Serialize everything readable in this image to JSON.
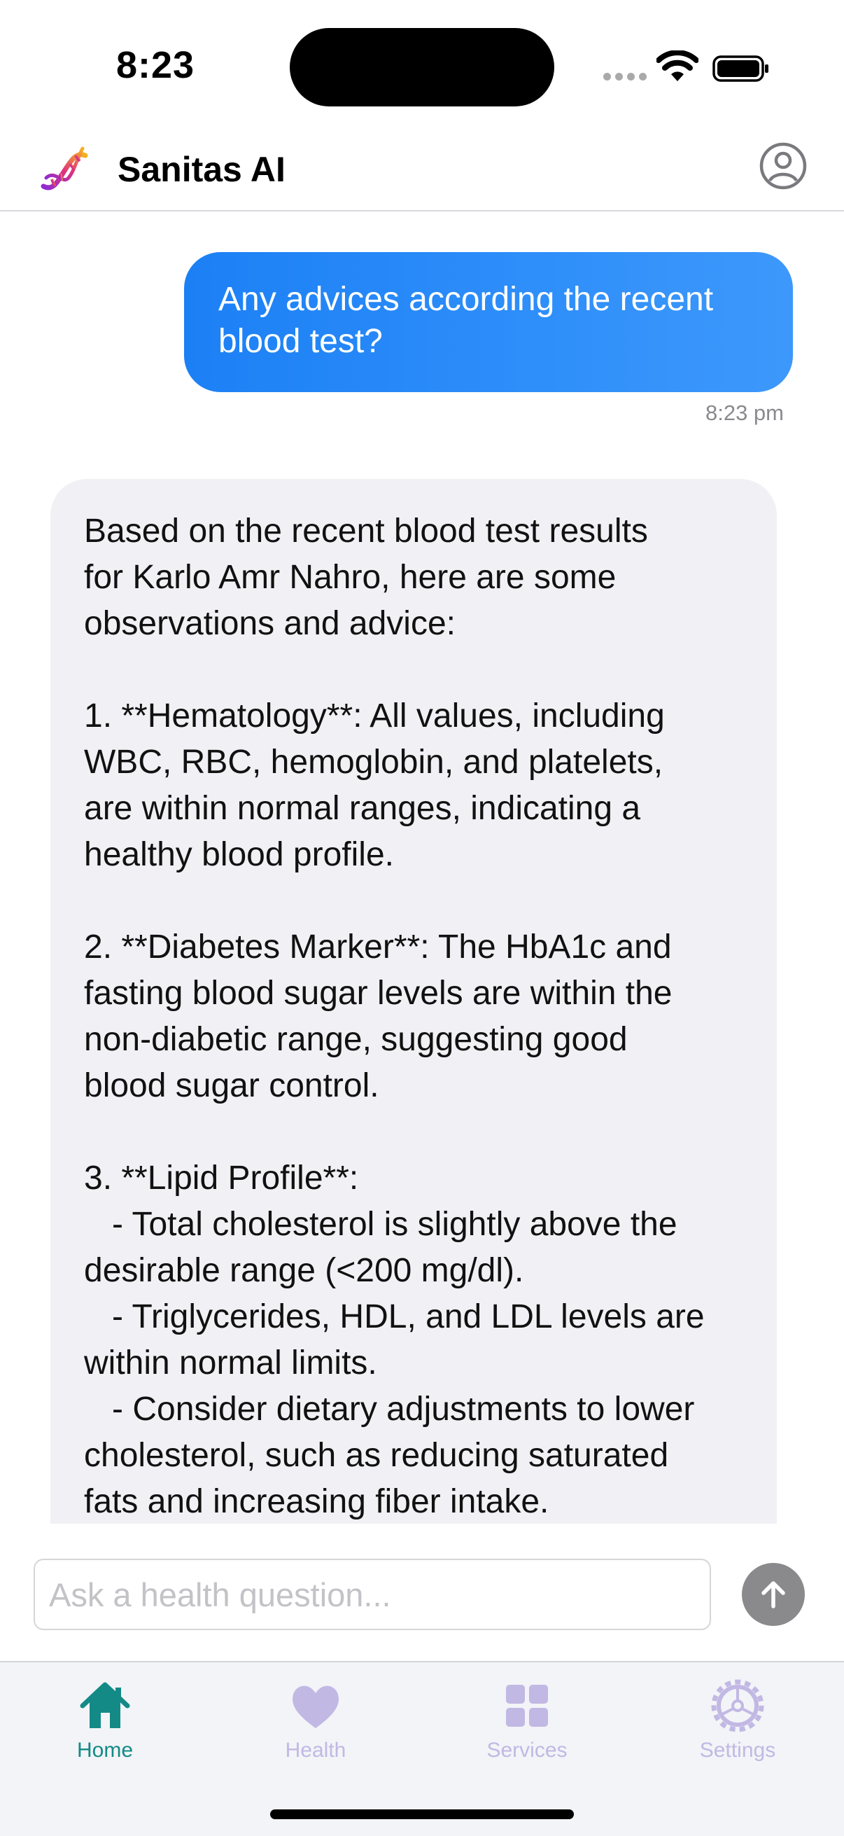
{
  "status_bar": {
    "time": "8:23"
  },
  "header": {
    "title": "Sanitas AI",
    "logo_icon": "dna-icon",
    "profile_icon": "person-circle-icon"
  },
  "chat": {
    "user_message": {
      "text": "Any advices according the recent blood test?",
      "time": "8:23 pm"
    },
    "ai_message": {
      "text": "Based on the recent blood test results\nfor Karlo Amr Nahro, here are some\nobservations and advice:\n\n1. **Hematology**: All values, including\nWBC, RBC, hemoglobin, and platelets,\nare within normal ranges, indicating a\nhealthy blood profile.\n\n2. **Diabetes Marker**: The HbA1c and\nfasting blood sugar levels are within the\nnon-diabetic range, suggesting good\nblood sugar control.\n\n3. **Lipid Profile**:\n   - Total cholesterol is slightly above the\ndesirable range (<200 mg/dl).\n   - Triglycerides, HDL, and LDL levels are\nwithin normal limits.\n   - Consider dietary adjustments to lower\ncholesterol, such as reducing saturated\nfats and increasing fiber intake."
    }
  },
  "input": {
    "placeholder": "Ask a health question...",
    "value": "",
    "send_icon": "arrow-up-icon"
  },
  "tabs": [
    {
      "label": "Home",
      "icon": "house-icon",
      "active": true
    },
    {
      "label": "Health",
      "icon": "heart-icon",
      "active": false
    },
    {
      "label": "Services",
      "icon": "grid-icon",
      "active": false
    },
    {
      "label": "Settings",
      "icon": "gear-icon",
      "active": false
    }
  ],
  "colors": {
    "accent_blue": "#1c80f5",
    "active_tab": "#138a86",
    "inactive_tab": "#c2b8e4",
    "ai_bubble": "#f1f1f5",
    "send_button": "#8a8a8d"
  }
}
